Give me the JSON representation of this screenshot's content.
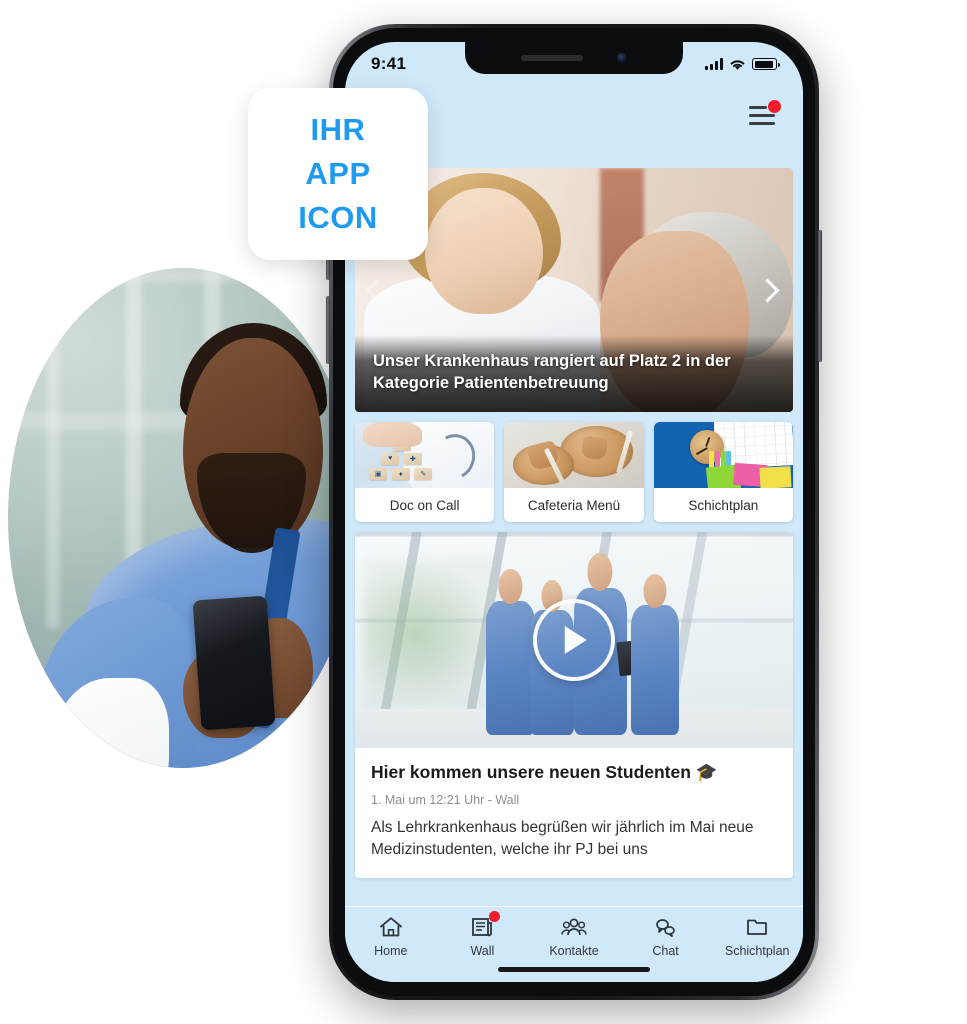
{
  "app_icon_placeholder": {
    "line1": "IHR",
    "line2": "APP",
    "line3": "ICON",
    "accent_color": "#1e9bf0"
  },
  "phone": {
    "status_bar": {
      "time": "9:41",
      "signal_icon": "signal-bars-icon",
      "wifi_icon": "wifi-icon",
      "battery_icon": "battery-icon"
    },
    "header": {
      "menu_icon": "hamburger-menu-icon",
      "menu_has_notification": true,
      "notification_color": "#f01e2c"
    },
    "screen_background": "#cfe9fa"
  },
  "hero": {
    "caption": "Unser Krankenhaus rangiert auf Platz 2 in der Kategorie Patientenbetreuung",
    "next_icon": "chevron-right-icon",
    "prev_icon": "chevron-left-icon",
    "image_alt": "nurse-with-elderly-patient"
  },
  "tiles": [
    {
      "label": "Doc on Call",
      "image_alt": "doctor-with-medical-icon-blocks"
    },
    {
      "label": "Cafeteria Menü",
      "image_alt": "wooden-plates-cups-and-forks"
    },
    {
      "label": "Schichtplan",
      "image_alt": "clock-calendar-and-sticky-notes"
    }
  ],
  "post": {
    "play_icon": "play-button-icon",
    "video_alt": "medical-students-walking-in-hospital-corridor",
    "title": "Hier kommen unsere neuen Studenten 🎓",
    "meta": "1. Mai um 12:21 Uhr - Wall",
    "text": "Als Lehrkrankenhaus begrüßen wir jährlich im Mai neue Medizinstudenten, welche ihr PJ bei uns"
  },
  "tabbar": [
    {
      "label": "Home",
      "icon": "home-icon",
      "badge": false
    },
    {
      "label": "Wall",
      "icon": "newspaper-icon",
      "badge": true
    },
    {
      "label": "Kontakte",
      "icon": "contacts-people-icon",
      "badge": false
    },
    {
      "label": "Chat",
      "icon": "chat-bubbles-icon",
      "badge": false
    },
    {
      "label": "Schichtplan",
      "icon": "folder-icon",
      "badge": false
    }
  ],
  "side_photo": {
    "image_alt": "male-nurse-in-blue-scrubs-using-smartphone"
  }
}
